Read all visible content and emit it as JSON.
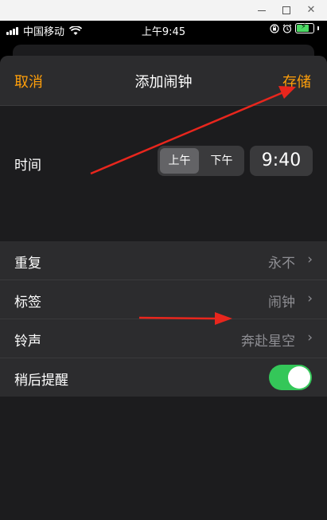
{
  "window": {
    "minimize_label": "—",
    "maximize_label": "□",
    "close_label": "✕"
  },
  "status_bar": {
    "carrier": "中国移动",
    "time": "上午9:45",
    "icons": [
      "signal-icon",
      "wifi-icon",
      "lock-rotation-icon",
      "alarm-icon",
      "battery-icon"
    ]
  },
  "nav": {
    "cancel": "取消",
    "title": "添加闹钟",
    "save": "存储"
  },
  "time_picker": {
    "label": "时间",
    "am": "上午",
    "pm": "下午",
    "selected_period": "上午",
    "value": "9:40"
  },
  "settings": {
    "repeat": {
      "label": "重复",
      "value": "永不"
    },
    "tag": {
      "label": "标签",
      "value": "闹钟"
    },
    "ringtone": {
      "label": "铃声",
      "value": "奔赴星空"
    },
    "snooze": {
      "label": "稍后提醒",
      "enabled": true
    }
  },
  "colors": {
    "accent": "#ff9f0a",
    "toggle_on": "#34c759",
    "annotation_arrow": "#e8261d",
    "sheet_bg": "#1c1c1e"
  }
}
